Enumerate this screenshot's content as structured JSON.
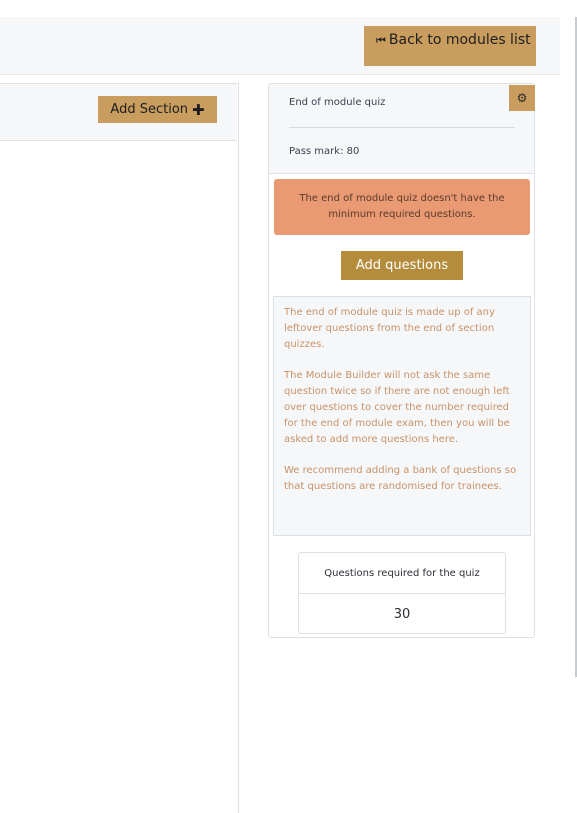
{
  "header": {
    "back_label": "Back to modules list",
    "back_icon": "step-backward-icon"
  },
  "builder": {
    "add_section_label": "Add Section",
    "add_section_icon": "plus-icon"
  },
  "quiz": {
    "title": "End of module quiz",
    "pass_mark": "Pass mark: 80",
    "settings_icon": "gear-icon",
    "alert": "The end of module quiz doesn't have the minimum required questions.",
    "add_questions_label": "Add questions",
    "info": [
      "The end of module quiz is made up of any leftover questions from the end of section quizzes.",
      "The Module Builder will not ask the same question twice so if there are not enough left over questions to cover the number required for the end of module exam, then you will be asked to add more questions here.",
      "We recommend adding a bank of questions so that questions are randomised for trainees."
    ],
    "required_header": "Questions required for the quiz",
    "required_value": "30"
  },
  "colors": {
    "accent": "#c89d5e",
    "accent_dark": "#b48c3c",
    "alert_bg": "#e99a72",
    "info_text": "#c99268"
  }
}
